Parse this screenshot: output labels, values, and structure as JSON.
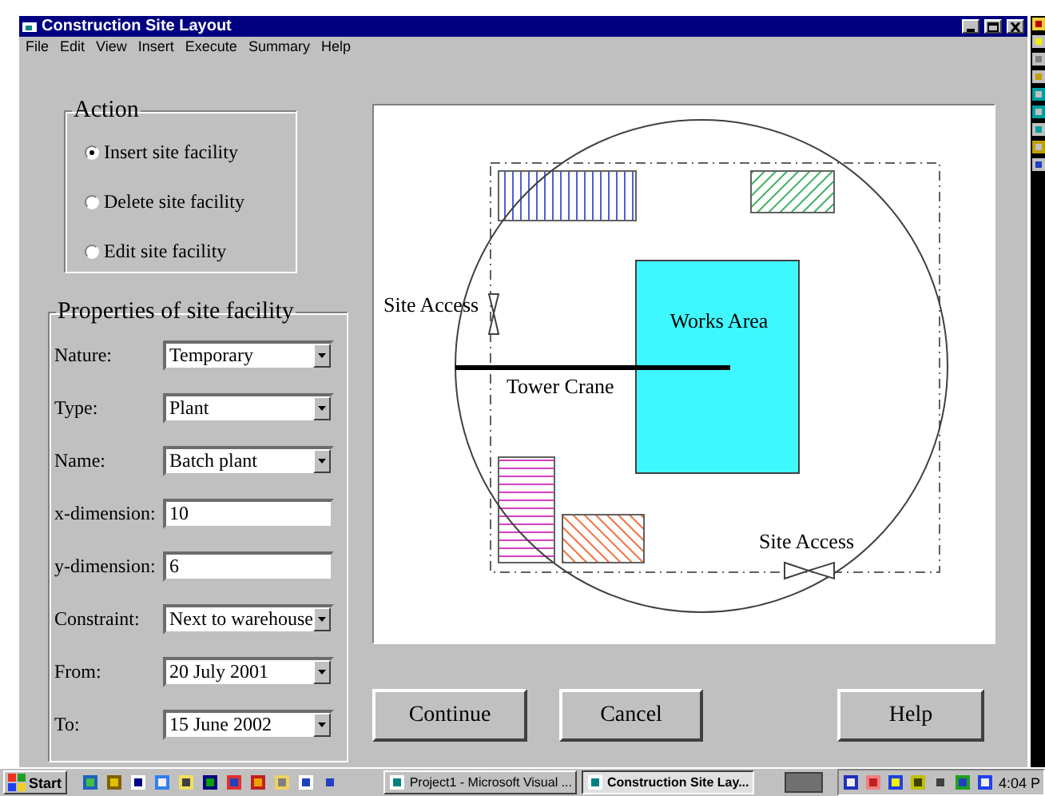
{
  "window": {
    "title": "Construction Site Layout"
  },
  "menu": [
    "File",
    "Edit",
    "View",
    "Insert",
    "Execute",
    "Summary",
    "Help"
  ],
  "action": {
    "title": "Action",
    "options": [
      {
        "label": "Insert site facility",
        "selected": true
      },
      {
        "label": "Delete site facility",
        "selected": false
      },
      {
        "label": "Edit site facility",
        "selected": false
      }
    ]
  },
  "properties": {
    "title": "Properties of site facility",
    "fields": [
      {
        "label": "Nature:",
        "kind": "dropdown",
        "value": "Temporary"
      },
      {
        "label": "Type:",
        "kind": "dropdown",
        "value": "Plant"
      },
      {
        "label": "Name:",
        "kind": "dropdown",
        "value": "Batch plant"
      },
      {
        "label": "x-dimension:",
        "kind": "text",
        "value": "10"
      },
      {
        "label": "y-dimension:",
        "kind": "text",
        "value": "6"
      },
      {
        "label": "Constraint:",
        "kind": "dropdown",
        "value": "Next to warehouse"
      },
      {
        "label": "From:",
        "kind": "dropdown",
        "value": "20 July 2001"
      },
      {
        "label": "To:",
        "kind": "dropdown",
        "value": "15 June 2002"
      }
    ]
  },
  "site_plan": {
    "access_labels": [
      "Site Access",
      "Site Access"
    ],
    "works_area": "Works Area",
    "crane": "Tower Crane"
  },
  "buttons": [
    "Continue",
    "Cancel",
    "Help"
  ],
  "taskbar": {
    "start": "Start",
    "tasks": [
      {
        "label": "Project1 - Microsoft Visual ...",
        "selected": false
      },
      {
        "label": "Construction Site Lay...",
        "selected": true
      }
    ],
    "clock": "4:04 P"
  }
}
